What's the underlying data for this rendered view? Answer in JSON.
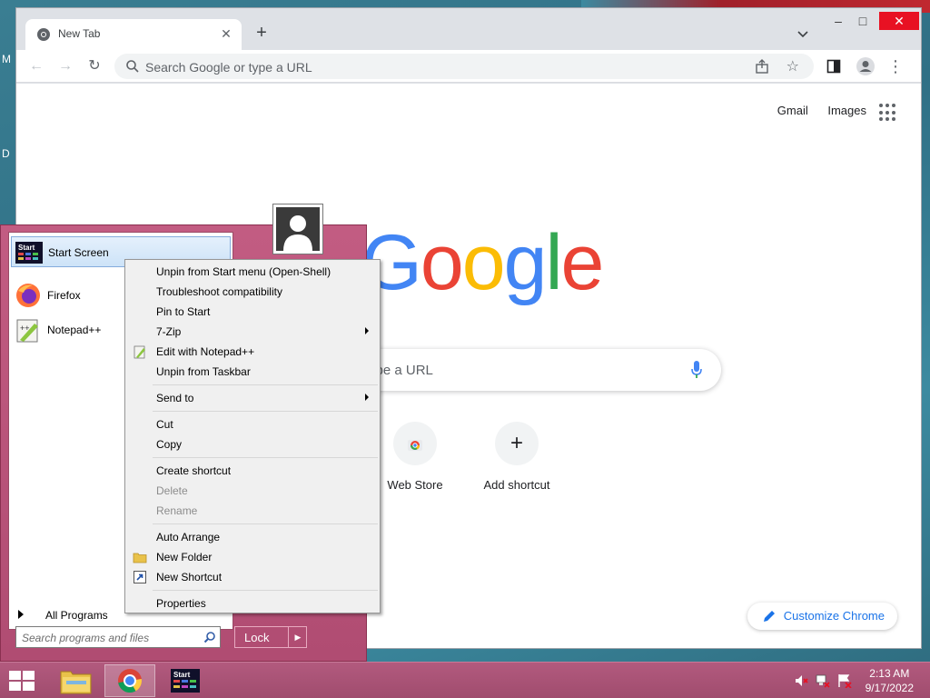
{
  "desktop": {
    "edge_labels": [
      "M",
      "D"
    ]
  },
  "chrome": {
    "tab_title": "New Tab",
    "new_tab_symbol": "+",
    "omnibox_placeholder": "Search Google or type a URL",
    "window_controls": {
      "minimize": "–",
      "maximize": "□",
      "close": "✕"
    },
    "top_links": [
      "Gmail",
      "Images"
    ],
    "logo_letters": [
      "G",
      "o",
      "o",
      "g",
      "l",
      "e"
    ],
    "search_placeholder": "Search Google or type a URL",
    "search_visible_text": "ype a URL",
    "shortcuts": [
      {
        "label": "Web Store",
        "icon": "chrome-webstore-icon"
      },
      {
        "label": "Add shortcut",
        "symbol": "+"
      }
    ],
    "customize_label": "Customize Chrome"
  },
  "start_menu": {
    "items": [
      {
        "label": "Start Screen",
        "icon": "start-screen-icon",
        "selected": true
      },
      {
        "label": "Firefox",
        "icon": "firefox-icon"
      },
      {
        "label": "Notepad++",
        "icon": "notepad-plus-plus-icon"
      }
    ],
    "start_icon_text": "Start",
    "all_programs": "All Programs",
    "search_placeholder": "Search programs and files",
    "lock_label": "Lock",
    "lock_arrow": "▶"
  },
  "context_menu": {
    "items": [
      {
        "label": "Unpin from Start menu (Open-Shell)"
      },
      {
        "label": "Troubleshoot compatibility"
      },
      {
        "label": "Pin to Start"
      },
      {
        "label": "7-Zip",
        "submenu": true
      },
      {
        "label": "Edit with Notepad++",
        "icon": "notepad-plus-plus-icon"
      },
      {
        "label": "Unpin from Taskbar"
      },
      {
        "label": "Send to",
        "submenu": true
      },
      {
        "label": "Cut"
      },
      {
        "label": "Copy"
      },
      {
        "label": "Create shortcut"
      },
      {
        "label": "Delete",
        "disabled": true
      },
      {
        "label": "Rename",
        "disabled": true
      },
      {
        "label": "Auto Arrange"
      },
      {
        "label": "New Folder",
        "icon": "folder-icon"
      },
      {
        "label": "New Shortcut",
        "icon": "shortcut-icon"
      },
      {
        "label": "Properties"
      }
    ]
  },
  "taskbar": {
    "apps": [
      "file-explorer-icon",
      "chrome-icon",
      "start-screen-icon"
    ],
    "active_app": "chrome-icon",
    "start_icon_text": "Start",
    "tray_icons": [
      "volume-muted-icon",
      "network-disconnected-icon",
      "action-center-alert-icon"
    ],
    "time": "2:13 AM",
    "date": "9/17/2022"
  },
  "colors": {
    "start_menu_bg": "#c25c82",
    "taskbar_bg": "#b25a7e",
    "close_button": "#e81123",
    "google_blue": "#4285f4",
    "google_red": "#ea4335",
    "google_yellow": "#fbbc05",
    "google_green": "#34a853"
  }
}
